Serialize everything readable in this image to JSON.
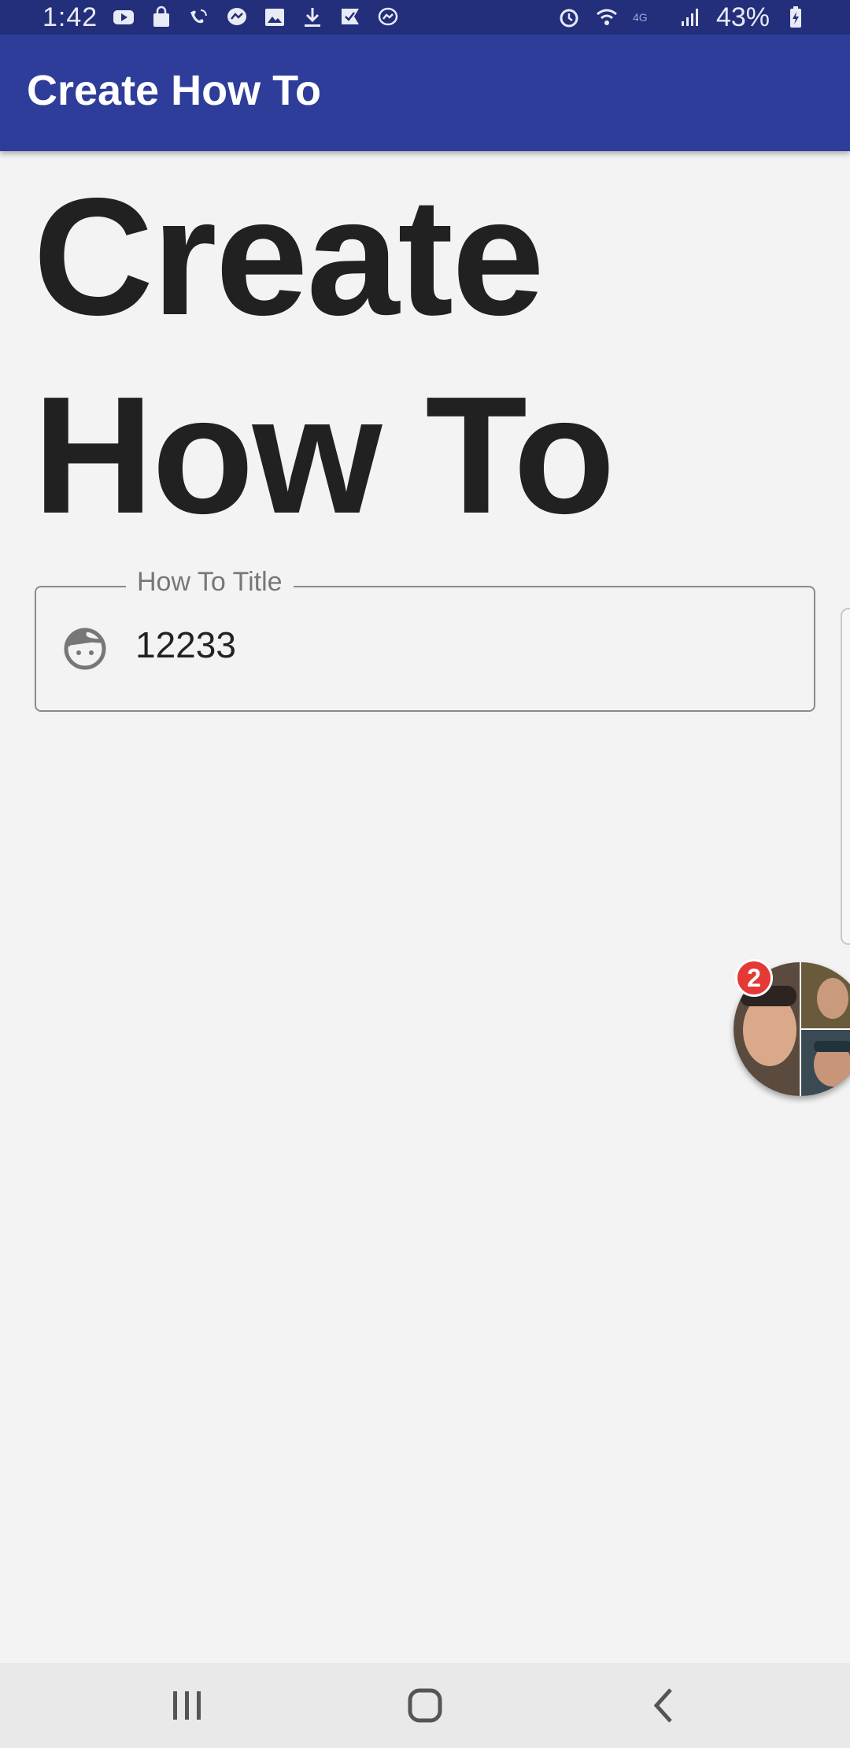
{
  "status_bar": {
    "time": "1:42",
    "battery_percent": "43%",
    "left_icons": [
      "youtube-icon",
      "shopping-bag-icon",
      "wifi-call-icon",
      "messenger-icon",
      "image-icon",
      "download-icon",
      "check-flag-icon",
      "messenger-outline-icon"
    ],
    "right_icons": [
      "alarm-icon",
      "wifi-icon",
      "lte-icon",
      "signal-icon",
      "battery-charging-icon"
    ]
  },
  "app_bar": {
    "title": "Create How To",
    "color": "#2e3d99"
  },
  "main": {
    "heading_line1": "Create",
    "heading_line2": "How To",
    "title_field": {
      "label": "How To Title",
      "value": "12233",
      "icon": "face-icon"
    }
  },
  "chat_head": {
    "badge_count": "2",
    "icon": "messenger-chat-head"
  },
  "nav_bar": {
    "buttons": [
      "recents-icon",
      "home-icon",
      "back-icon"
    ]
  }
}
